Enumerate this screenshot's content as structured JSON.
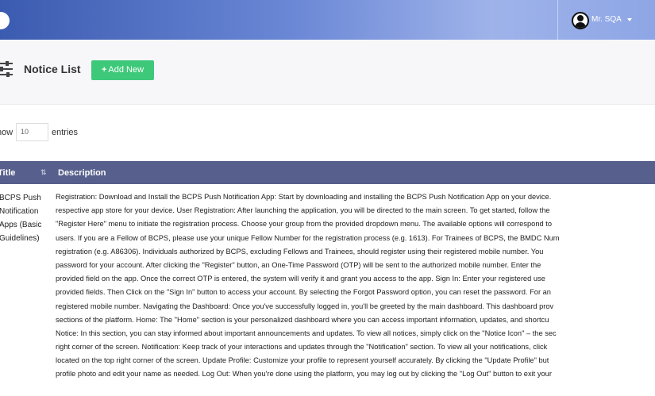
{
  "header": {
    "user_name": "Mr. SQA"
  },
  "page": {
    "title": "Notice List",
    "add_button": "Add New",
    "add_icon": "+"
  },
  "entries": {
    "show_label": "how",
    "value": "10",
    "entries_label": "entries"
  },
  "table": {
    "columns": [
      "Title",
      "Description"
    ],
    "sort_icon": "⇅",
    "rows": [
      {
        "title_lines": [
          "BCPS Push",
          "Notification",
          "Apps (Basic",
          "Guidelines)"
        ],
        "description_lines": [
          "Registration:     Download and Install the BCPS Push Notification App: Start by downloading and installing the BCPS Push Notification App on your device.",
          "respective app store for your device.     User Registration: After launching the application, you will be directed to the main screen. To get started, follow the",
          "\"Register Here\" menu to initiate the registration process.     Choose your group from the provided dropdown menu. The available options will correspond to",
          "users.     If you are a Fellow of BCPS, please use your unique Fellow Number for the registration process (e.g. 1613).     For Trainees of BCPS, the BMDC Num",
          "registration (e.g. A86306).     Individuals authorized by BCPS, excluding Fellows and Trainees, should register using their registered mobile number.     You",
          "password for your account.     After clicking the \"Register\" button, an One-Time Password (OTP) will be sent to the authorized mobile number.     Enter the",
          "provided field on the app.     Once the correct OTP is entered, the system will verify it and grant you access to the app. Sign In:     Enter your registered use",
          "provided fields. Then Click on the \"Sign In\" button to access your account.     By selecting the Forgot Password option, you can reset the password. For an",
          "registered mobile number. Navigating the Dashboard:     Once you've successfully logged in, you'll be greeted by the main dashboard. This dashboard prov",
          "sections of the platform.     Home: The \"Home\" section is your personalized dashboard where you can access important information, updates, and shortcu",
          "Notice: In this section, you can stay informed about important announcements and updates. To view all notices, simply click on the \"Notice Icon\" – the sec",
          "right corner of the screen.     Notification: Keep track of your interactions and updates through the \"Notification\" section. To view all your notifications, click",
          "located on the top right corner of the screen.     Update Profile: Customize your profile to represent yourself accurately. By clicking the \"Update Profile\" but",
          "profile photo and edit your name as needed.     Log Out: When you're done using the platform, you may log out by clicking the \"Log Out\" button to exit your"
        ]
      }
    ]
  }
}
